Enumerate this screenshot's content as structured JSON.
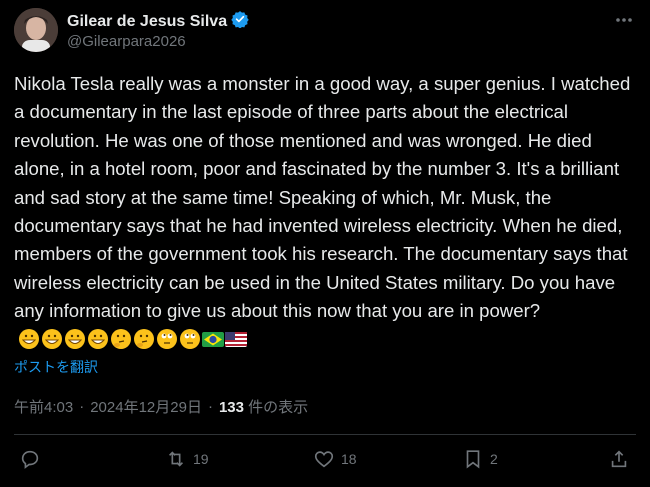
{
  "author": {
    "name": "Gilear de Jesus Silva",
    "handle": "@Gilearpara2026"
  },
  "tweet": {
    "text": "Nikola Tesla really was a monster in a good way, a super genius. I watched a documentary in the last episode of three parts about the electrical revolution. He was one of those mentioned and was wronged. He died alone, in a hotel room, poor and fascinated by the number 3. It's a brilliant and sad story at the same time! Speaking of which, Mr. Musk, the documentary says that he had invented wireless electricity. When he died, members of the government took his research. The documentary says that wireless electricity can be used in the United States military. Do you have any information to give us about this now that you are in power?",
    "emojis": [
      "grinning",
      "grinning",
      "grinning",
      "grinning",
      "thinking",
      "thinking",
      "eye-roll",
      "eye-roll",
      "brazil-flag",
      "us-flag"
    ],
    "translate_label": "ポストを翻訳"
  },
  "meta": {
    "time": "午前4:03",
    "date": "2024年12月29日",
    "views_count": "133",
    "views_label": "件の表示",
    "sep": "·"
  },
  "actions": {
    "reposts": "19",
    "likes": "18",
    "bookmarks": "2"
  },
  "colors": {
    "background": "#000000",
    "text": "#e7e9ea",
    "muted": "#71767b",
    "link": "#1d9bf0",
    "verified": "#1d9bf0"
  }
}
